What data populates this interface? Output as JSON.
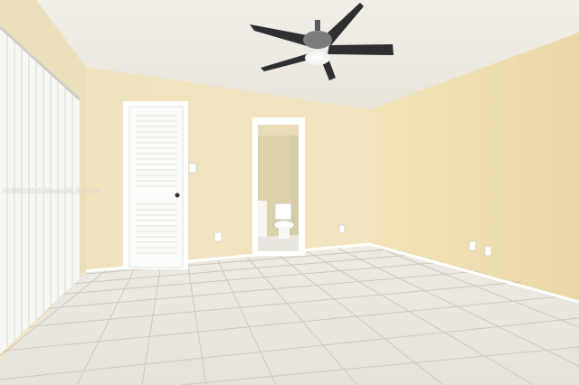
{
  "photo": {
    "watermark": "A1666033 © Miami MLS 2024"
  },
  "colors": {
    "ceiling": "#eeeae0",
    "wall_back": "#f1e4be",
    "wall_right": "#efdeb2",
    "wall_left": "#ece0bc",
    "floor": "#ece8e2",
    "grout": "#c9c3ba",
    "trim": "#ffffff",
    "fan_blade": "#2e2e30"
  }
}
